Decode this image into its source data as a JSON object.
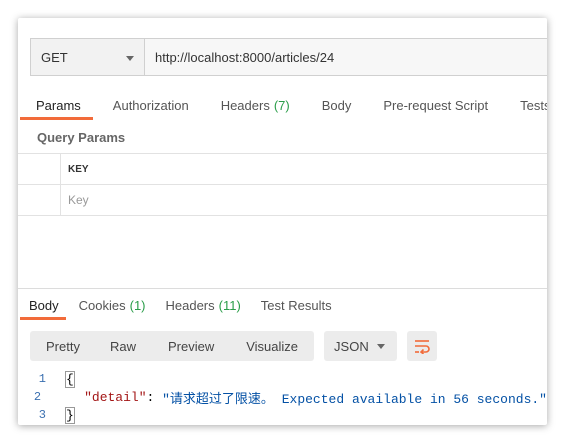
{
  "request": {
    "method": "GET",
    "url": "http://localhost:8000/articles/24"
  },
  "request_tabs": [
    {
      "label": "Params",
      "count": ""
    },
    {
      "label": "Authorization",
      "count": ""
    },
    {
      "label": "Headers",
      "count": "(7)"
    },
    {
      "label": "Body",
      "count": ""
    },
    {
      "label": "Pre-request Script",
      "count": ""
    },
    {
      "label": "Tests",
      "count": ""
    }
  ],
  "query_params": {
    "title": "Query Params",
    "key_header": "KEY",
    "key_placeholder": "Key"
  },
  "response_tabs": [
    {
      "label": "Body",
      "count": ""
    },
    {
      "label": "Cookies",
      "count": "(1)"
    },
    {
      "label": "Headers",
      "count": "(11)"
    },
    {
      "label": "Test Results",
      "count": ""
    }
  ],
  "view_modes": [
    "Pretty",
    "Raw",
    "Preview",
    "Visualize"
  ],
  "format": "JSON",
  "icons": {
    "method_dropdown": "chevron-down-icon",
    "format_dropdown": "chevron-down-icon",
    "wrap": "wrap-lines-icon"
  },
  "colors": {
    "accent": "#f26b3a",
    "count_green": "#2a9d49",
    "json_key": "#a31515",
    "json_string": "#0451a5"
  },
  "response_body": {
    "line_numbers": [
      "1",
      "2",
      "3"
    ],
    "open_brace": "{",
    "key": "\"detail\"",
    "colon": ": ",
    "value": "\"请求超过了限速。 Expected available in 56 seconds.\"",
    "close_brace": "}"
  }
}
